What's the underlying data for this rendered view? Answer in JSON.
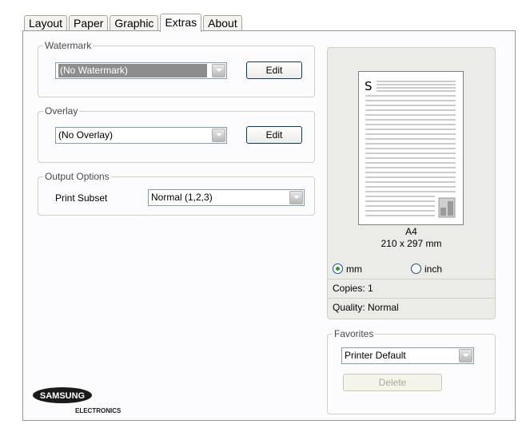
{
  "tabs": [
    {
      "label": "Layout"
    },
    {
      "label": "Paper"
    },
    {
      "label": "Graphic"
    },
    {
      "label": "Extras",
      "active": true
    },
    {
      "label": "About"
    }
  ],
  "watermark": {
    "legend": "Watermark",
    "selected": "(No Watermark)",
    "edit_label": "Edit"
  },
  "overlay": {
    "legend": "Overlay",
    "selected": "(No Overlay)",
    "edit_label": "Edit"
  },
  "output": {
    "legend": "Output Options",
    "print_subset_label": "Print Subset",
    "print_subset_value": "Normal (1,2,3)"
  },
  "preview": {
    "page_letter": "S",
    "paper_name": "A4",
    "paper_dims": "210 x 297 mm",
    "unit_mm": "mm",
    "unit_inch": "inch",
    "selected_unit": "mm",
    "copies": "Copies: 1",
    "quality": "Quality: Normal"
  },
  "favorites": {
    "legend": "Favorites",
    "selected": "Printer Default",
    "delete_label": "Delete"
  },
  "logo": {
    "brand": "SAMSUNG",
    "sub": "ELECTRONICS",
    "color": "#1a1a1a"
  },
  "colors": {
    "panel_bg": "#fcfcfe",
    "border": "#919b9c",
    "group_border": "#d0d0bf",
    "button_border": "#003c74"
  }
}
